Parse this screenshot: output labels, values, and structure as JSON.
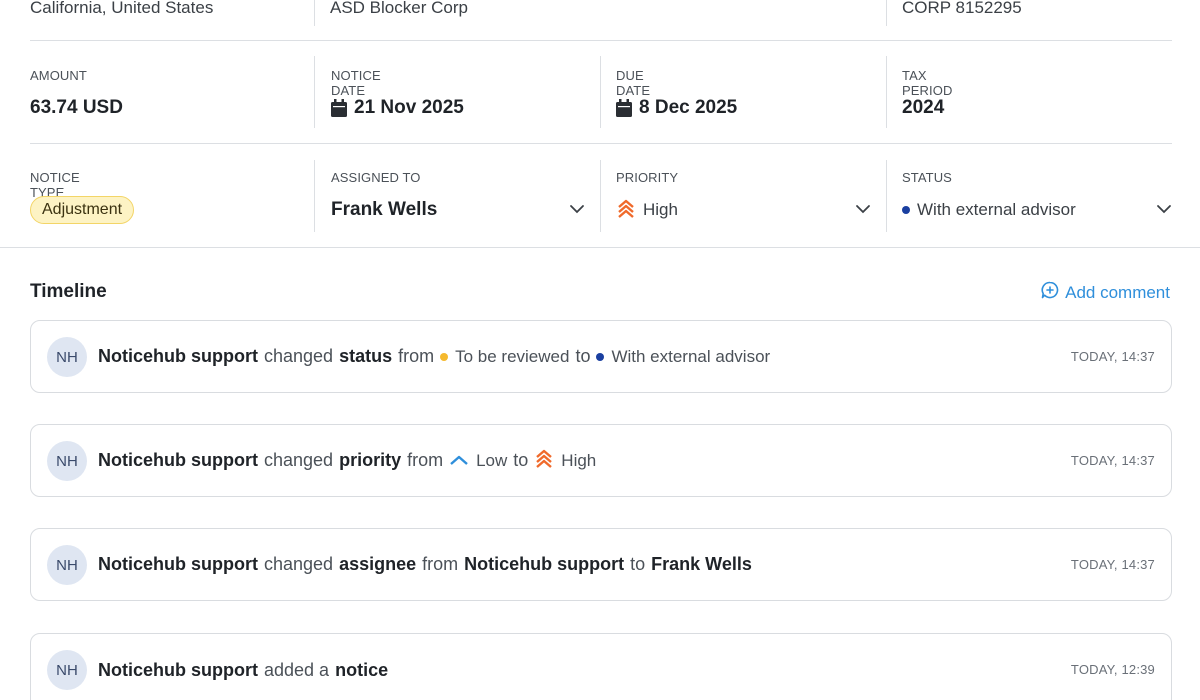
{
  "header": {
    "location": "California, United States",
    "company": "ASD Blocker Corp",
    "corp_id": "CORP 8152295"
  },
  "details": {
    "amount_label": "AMOUNT",
    "amount_value": "63.74 USD",
    "notice_date_label": "NOTICE DATE",
    "notice_date_value": "21 Nov 2025",
    "due_date_label": "DUE DATE",
    "due_date_value": "8 Dec 2025",
    "tax_period_label": "TAX PERIOD",
    "tax_period_value": "2024"
  },
  "meta": {
    "notice_type_label": "NOTICE TYPE",
    "notice_type_value": "Adjustment",
    "assigned_label": "ASSIGNED TO",
    "assigned_value": "Frank Wells",
    "priority_label": "PRIORITY",
    "priority_value": "High",
    "status_label": "STATUS",
    "status_value": "With external advisor"
  },
  "colors": {
    "status_to_review": "#f5b92e",
    "status_external": "#1a3fa0",
    "priority_high": "#f06a2b",
    "priority_low": "#2f8fdb",
    "link": "#2f8fdb"
  },
  "icons": {
    "calendar": "calendar-icon",
    "chevron": "chevron-down-icon",
    "priority_high": "priority-high-icon",
    "priority_low": "priority-low-icon",
    "comment": "comment-plus-icon"
  },
  "timeline": {
    "title": "Timeline",
    "add_comment": "Add comment",
    "events": [
      {
        "avatar": "NH",
        "actor": "Noticehub support",
        "verb": "changed",
        "field": "status",
        "from_word": "from",
        "from_value": "To be reviewed",
        "to_word": "to",
        "to_value": "With external advisor",
        "time": "TODAY, 14:37"
      },
      {
        "avatar": "NH",
        "actor": "Noticehub support",
        "verb": "changed",
        "field": "priority",
        "from_word": "from",
        "from_value": "Low",
        "to_word": "to",
        "to_value": "High",
        "time": "TODAY, 14:37"
      },
      {
        "avatar": "NH",
        "actor": "Noticehub support",
        "verb": "changed",
        "field": "assignee",
        "from_word": "from",
        "from_value": "Noticehub support",
        "to_word": "to",
        "to_value": "Frank Wells",
        "time": "TODAY, 14:37"
      },
      {
        "avatar": "NH",
        "actor": "Noticehub support",
        "verb": "added a",
        "field": "notice",
        "time": "TODAY, 12:39"
      }
    ]
  }
}
